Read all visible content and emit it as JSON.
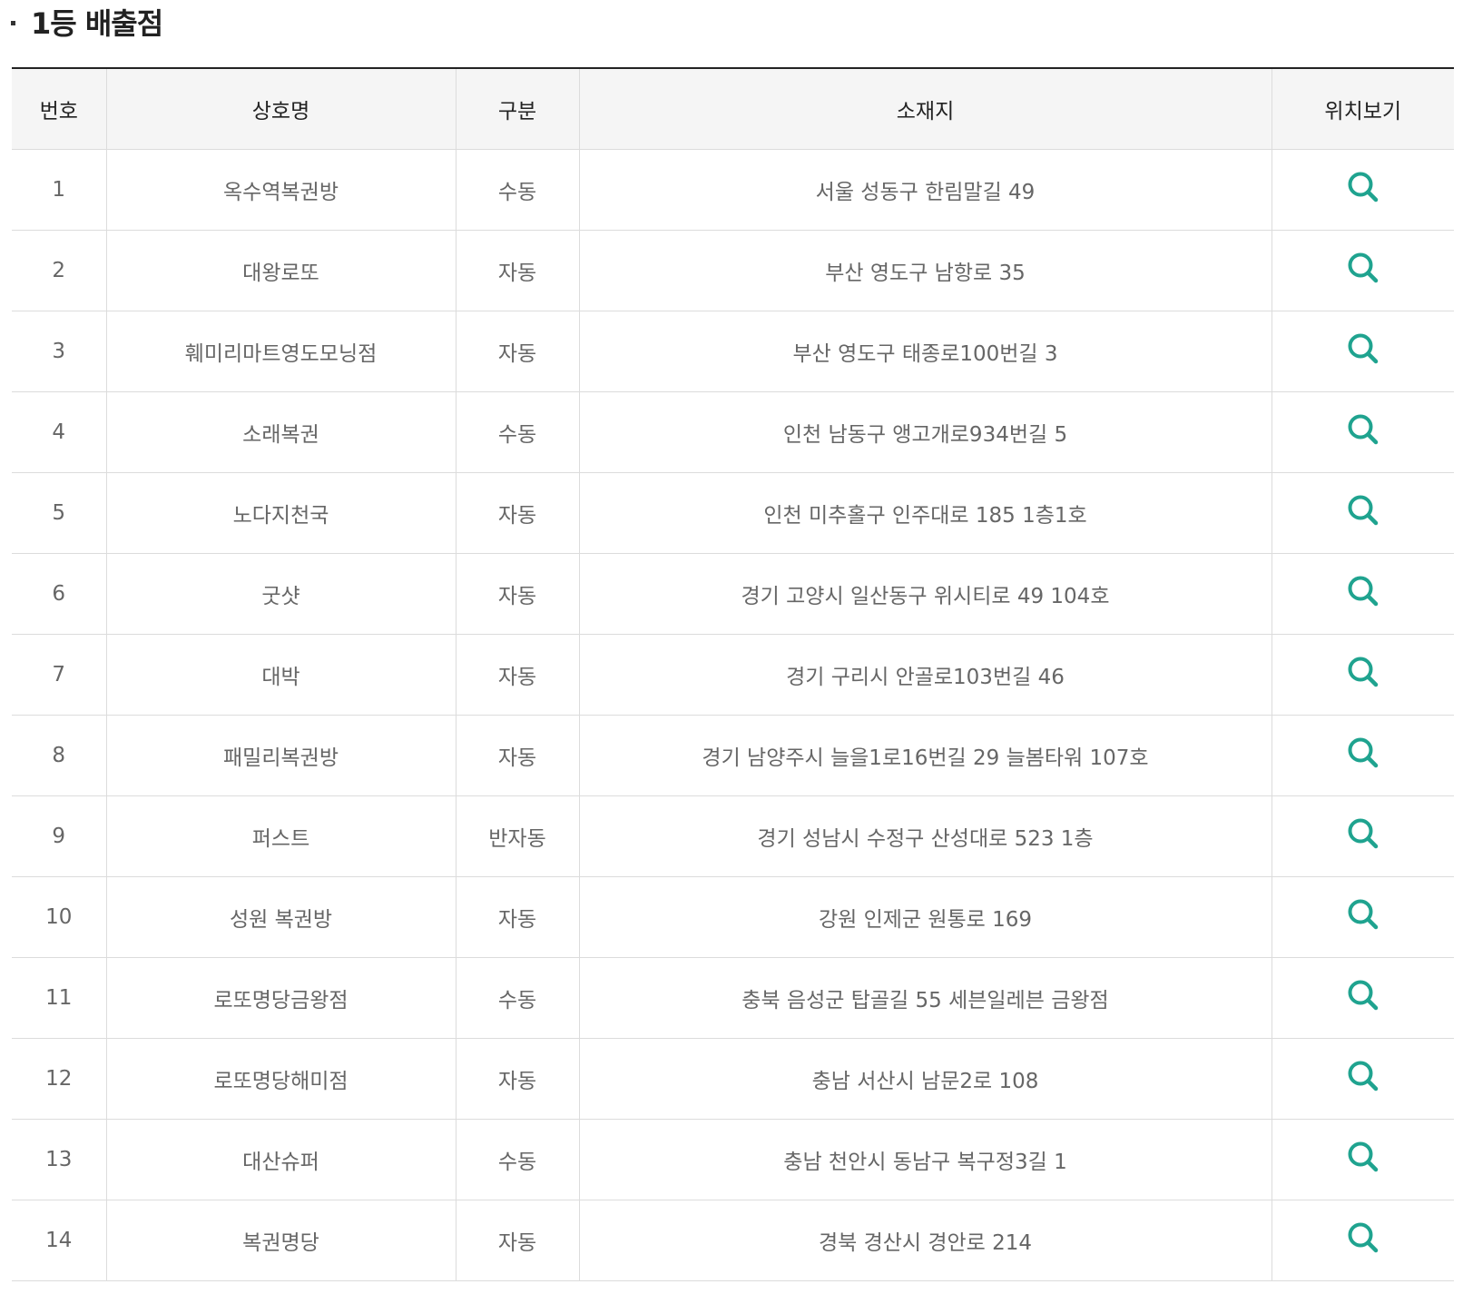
{
  "page": {
    "heading": "1등 배출점"
  },
  "table": {
    "headers": {
      "no": "번호",
      "name": "상호명",
      "type": "구분",
      "address": "소재지",
      "location": "위치보기"
    },
    "rows": [
      {
        "no": "1",
        "name": "옥수역복권방",
        "type": "수동",
        "address": "서울 성동구 한림말길 49"
      },
      {
        "no": "2",
        "name": "대왕로또",
        "type": "자동",
        "address": "부산 영도구 남항로 35"
      },
      {
        "no": "3",
        "name": "훼미리마트영도모닝점",
        "type": "자동",
        "address": "부산 영도구 태종로100번길 3"
      },
      {
        "no": "4",
        "name": "소래복권",
        "type": "수동",
        "address": "인천 남동구 앵고개로934번길 5"
      },
      {
        "no": "5",
        "name": "노다지천국",
        "type": "자동",
        "address": "인천 미추홀구 인주대로 185 1층1호"
      },
      {
        "no": "6",
        "name": "굿샷",
        "type": "자동",
        "address": "경기 고양시 일산동구 위시티로 49 104호"
      },
      {
        "no": "7",
        "name": "대박",
        "type": "자동",
        "address": "경기 구리시 안골로103번길 46"
      },
      {
        "no": "8",
        "name": "패밀리복권방",
        "type": "자동",
        "address": "경기 남양주시 늘을1로16번길 29 늘봄타워 107호"
      },
      {
        "no": "9",
        "name": "퍼스트",
        "type": "반자동",
        "address": "경기 성남시 수정구 산성대로 523 1층"
      },
      {
        "no": "10",
        "name": "성원 복권방",
        "type": "자동",
        "address": "강원 인제군 원통로 169"
      },
      {
        "no": "11",
        "name": "로또명당금왕점",
        "type": "수동",
        "address": "충북 음성군 탑골길 55 세븐일레븐 금왕점"
      },
      {
        "no": "12",
        "name": "로또명당해미점",
        "type": "자동",
        "address": "충남 서산시 남문2로 108"
      },
      {
        "no": "13",
        "name": "대산슈퍼",
        "type": "수동",
        "address": "충남 천안시 동남구 복구정3길 1"
      },
      {
        "no": "14",
        "name": "복권명당",
        "type": "자동",
        "address": "경북 경산시 경안로 214"
      }
    ]
  },
  "icons": {
    "location": "search-icon"
  },
  "colors": {
    "icon_accent": "#1fa38f",
    "header_bg": "#f5f5f5",
    "top_border": "#222222",
    "grid_line": "#dcdcdc"
  }
}
